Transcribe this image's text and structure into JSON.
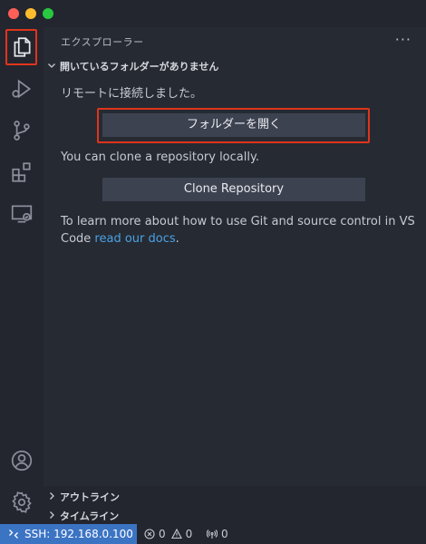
{
  "sidebar": {
    "title": "エクスプローラー",
    "more_label": "···",
    "no_folder": {
      "title": "開いているフォルダーがありません",
      "remote_message": "リモートに接続しました。",
      "open_folder_label": "フォルダーを開く",
      "clone_message": "You can clone a repository locally.",
      "clone_label": "Clone Repository",
      "learn_line1": "To learn more about how to use Git and source control in VS",
      "learn_prefix": "Code ",
      "learn_link": "read our docs",
      "learn_suffix": "."
    },
    "outline_title": "アウトライン",
    "timeline_title": "タイムライン"
  },
  "statusbar": {
    "remote_label": "SSH: 192.168.0.100",
    "errors": "0",
    "warnings": "0",
    "ports": "0"
  },
  "colors": {
    "highlight": "#e0341c",
    "remote_bg": "#3c74c4",
    "link": "#4aa2e6"
  }
}
